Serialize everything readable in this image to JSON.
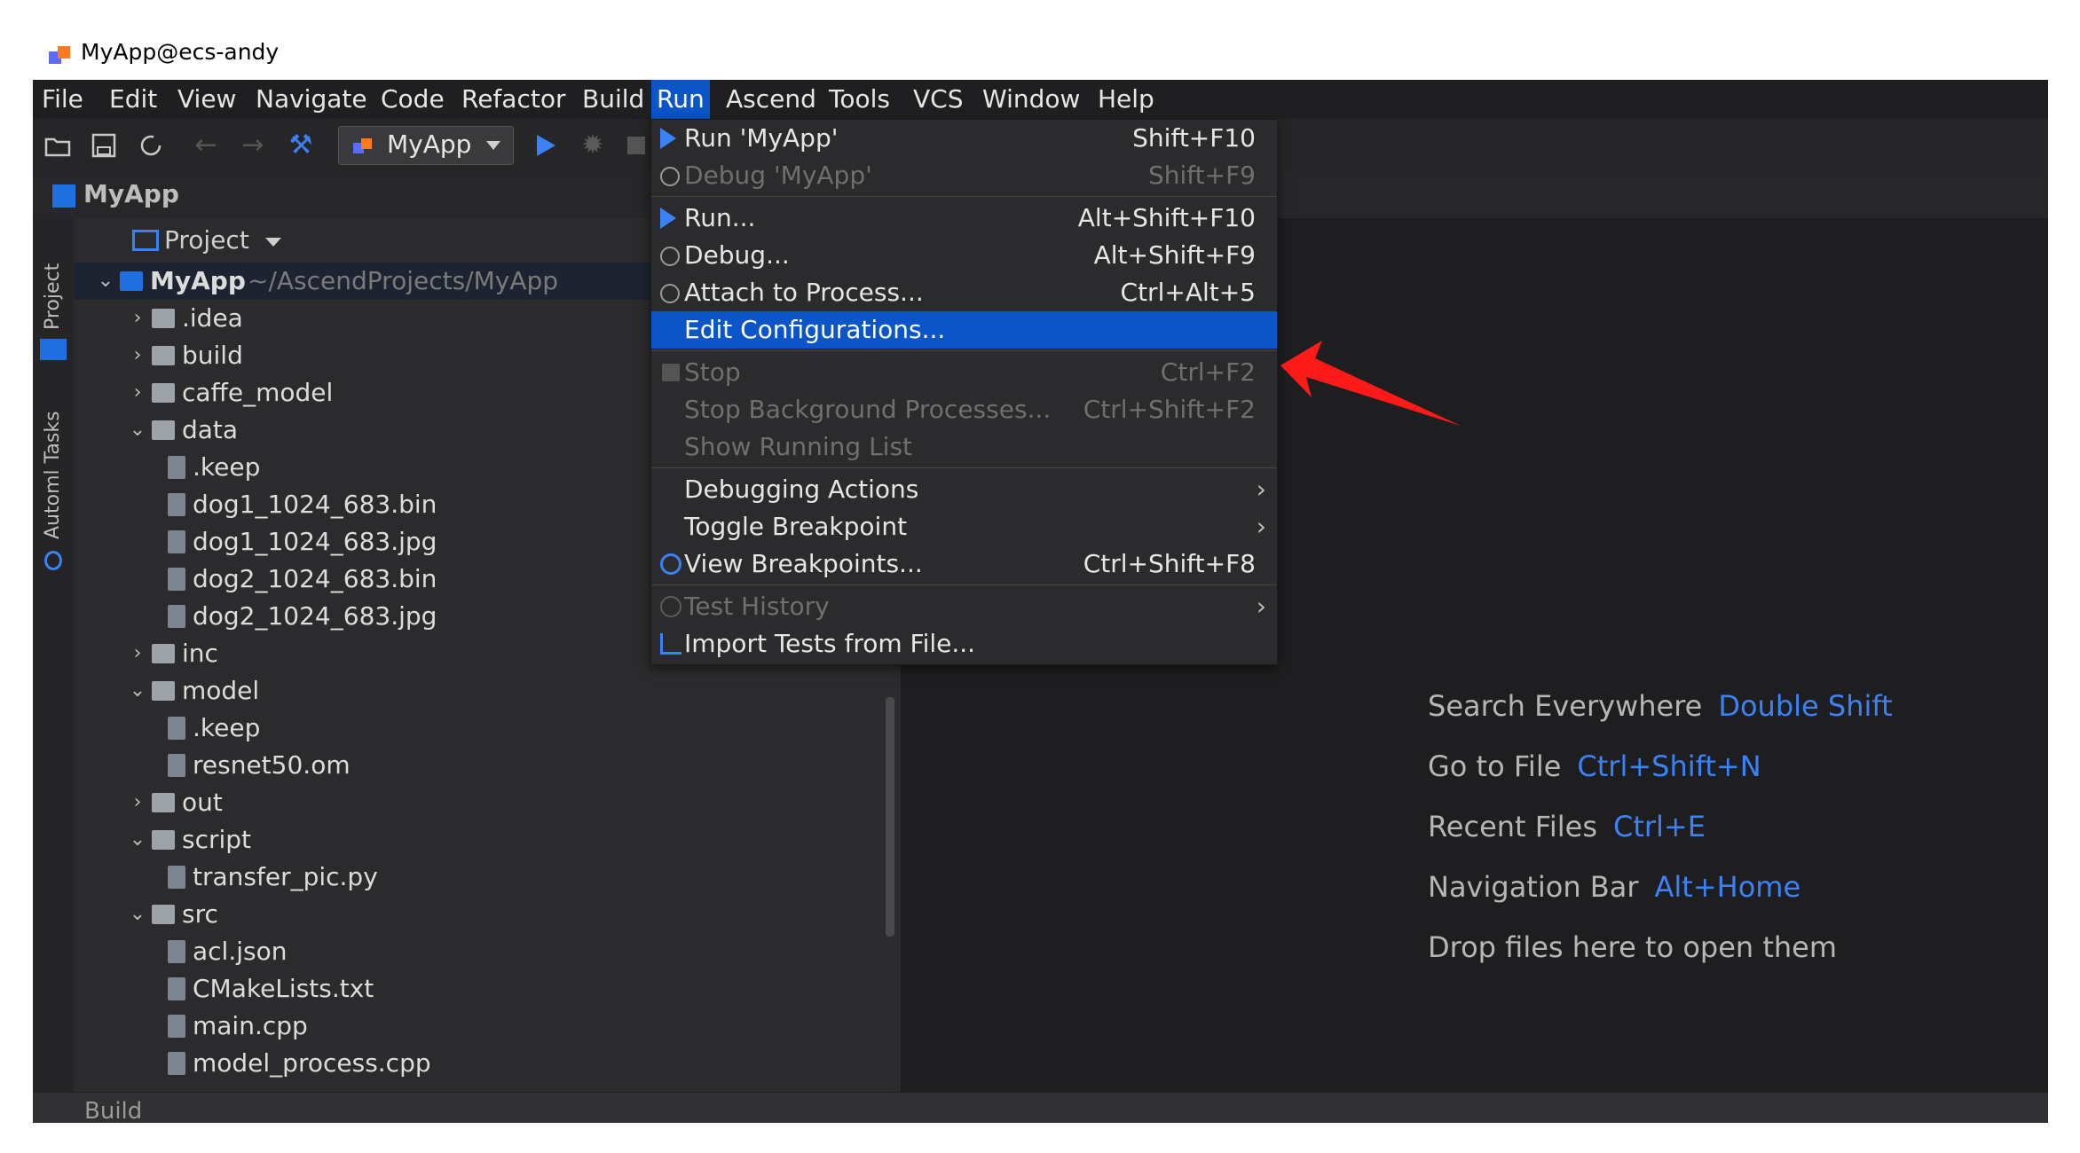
{
  "window": {
    "title": "MyApp@ecs-andy"
  },
  "menubar": {
    "items": [
      {
        "label": "File"
      },
      {
        "label": "Edit"
      },
      {
        "label": "View"
      },
      {
        "label": "Navigate"
      },
      {
        "label": "Code"
      },
      {
        "label": "Refactor"
      },
      {
        "label": "Build"
      },
      {
        "label": "Run"
      },
      {
        "label": "Ascend"
      },
      {
        "label": "Tools"
      },
      {
        "label": "VCS"
      },
      {
        "label": "Window"
      },
      {
        "label": "Help"
      }
    ],
    "active": "Run"
  },
  "toolbar": {
    "run_config": "MyApp"
  },
  "breadcrumb": {
    "project": "MyApp"
  },
  "side_tabs": {
    "project": "Project",
    "tasks": "Automl Tasks"
  },
  "project_panel": {
    "header": "Project",
    "tree": [
      {
        "name": "MyApp",
        "path": "~/AscendProjects/MyApp",
        "type": "root",
        "expanded": true
      },
      {
        "name": ".idea",
        "type": "folder",
        "expanded": false
      },
      {
        "name": "build",
        "type": "folder",
        "expanded": false
      },
      {
        "name": "caffe_model",
        "type": "folder",
        "expanded": false
      },
      {
        "name": "data",
        "type": "folder",
        "expanded": true
      },
      {
        "name": ".keep",
        "type": "file"
      },
      {
        "name": "dog1_1024_683.bin",
        "type": "file"
      },
      {
        "name": "dog1_1024_683.jpg",
        "type": "file"
      },
      {
        "name": "dog2_1024_683.bin",
        "type": "file"
      },
      {
        "name": "dog2_1024_683.jpg",
        "type": "file"
      },
      {
        "name": "inc",
        "type": "folder",
        "expanded": false
      },
      {
        "name": "model",
        "type": "folder",
        "expanded": true
      },
      {
        "name": ".keep",
        "type": "file"
      },
      {
        "name": "resnet50.om",
        "type": "file"
      },
      {
        "name": "out",
        "type": "folder",
        "expanded": false
      },
      {
        "name": "script",
        "type": "folder",
        "expanded": true
      },
      {
        "name": "transfer_pic.py",
        "type": "file"
      },
      {
        "name": "src",
        "type": "folder",
        "expanded": true
      },
      {
        "name": "acl.json",
        "type": "file"
      },
      {
        "name": "CMakeLists.txt",
        "type": "file"
      },
      {
        "name": "main.cpp",
        "type": "file"
      },
      {
        "name": "model_process.cpp",
        "type": "file"
      }
    ]
  },
  "run_menu": {
    "items": [
      {
        "label": "Run 'MyApp'",
        "shortcut": "Shift+F10",
        "icon": "play-icon",
        "disabled": false
      },
      {
        "label": "Debug 'MyApp'",
        "shortcut": "Shift+F9",
        "icon": "bug-icon",
        "disabled": true
      },
      {
        "label": "Run...",
        "shortcut": "Alt+Shift+F10",
        "icon": "play-icon",
        "disabled": false
      },
      {
        "label": "Debug...",
        "shortcut": "Alt+Shift+F9",
        "icon": "bug-icon",
        "disabled": false
      },
      {
        "label": "Attach to Process...",
        "shortcut": "Ctrl+Alt+5",
        "icon": "attach-icon",
        "disabled": false
      },
      {
        "label": "Edit Configurations...",
        "shortcut": "",
        "icon": "",
        "disabled": false,
        "highlighted": true
      },
      {
        "label": "Stop",
        "shortcut": "Ctrl+F2",
        "icon": "stop-icon",
        "disabled": true
      },
      {
        "label": "Stop Background Processes...",
        "shortcut": "Ctrl+Shift+F2",
        "icon": "",
        "disabled": true
      },
      {
        "label": "Show Running List",
        "shortcut": "",
        "icon": "",
        "disabled": true
      },
      {
        "label": "Debugging Actions",
        "shortcut": "",
        "icon": "",
        "disabled": false,
        "submenu": true
      },
      {
        "label": "Toggle Breakpoint",
        "shortcut": "",
        "icon": "",
        "disabled": false,
        "submenu": true
      },
      {
        "label": "View Breakpoints...",
        "shortcut": "Ctrl+Shift+F8",
        "icon": "breakpoints-icon",
        "disabled": false
      },
      {
        "label": "Test History",
        "shortcut": "",
        "icon": "history-icon",
        "disabled": true,
        "submenu": true
      },
      {
        "label": "Import Tests from File...",
        "shortcut": "",
        "icon": "import-icon",
        "disabled": false
      }
    ]
  },
  "editor_hints": [
    {
      "text": "Search Everywhere",
      "key": "Double Shift"
    },
    {
      "text": "Go to File",
      "key": "Ctrl+Shift+N"
    },
    {
      "text": "Recent Files",
      "key": "Ctrl+E"
    },
    {
      "text": "Navigation Bar",
      "key": "Alt+Home"
    },
    {
      "text": "Drop files here to open them",
      "key": ""
    }
  ],
  "bottom": {
    "tool_window": "Build"
  },
  "colors": {
    "accent": "#0b55c9",
    "link": "#3b82f6",
    "annotation_arrow": "#ff1a1a"
  }
}
